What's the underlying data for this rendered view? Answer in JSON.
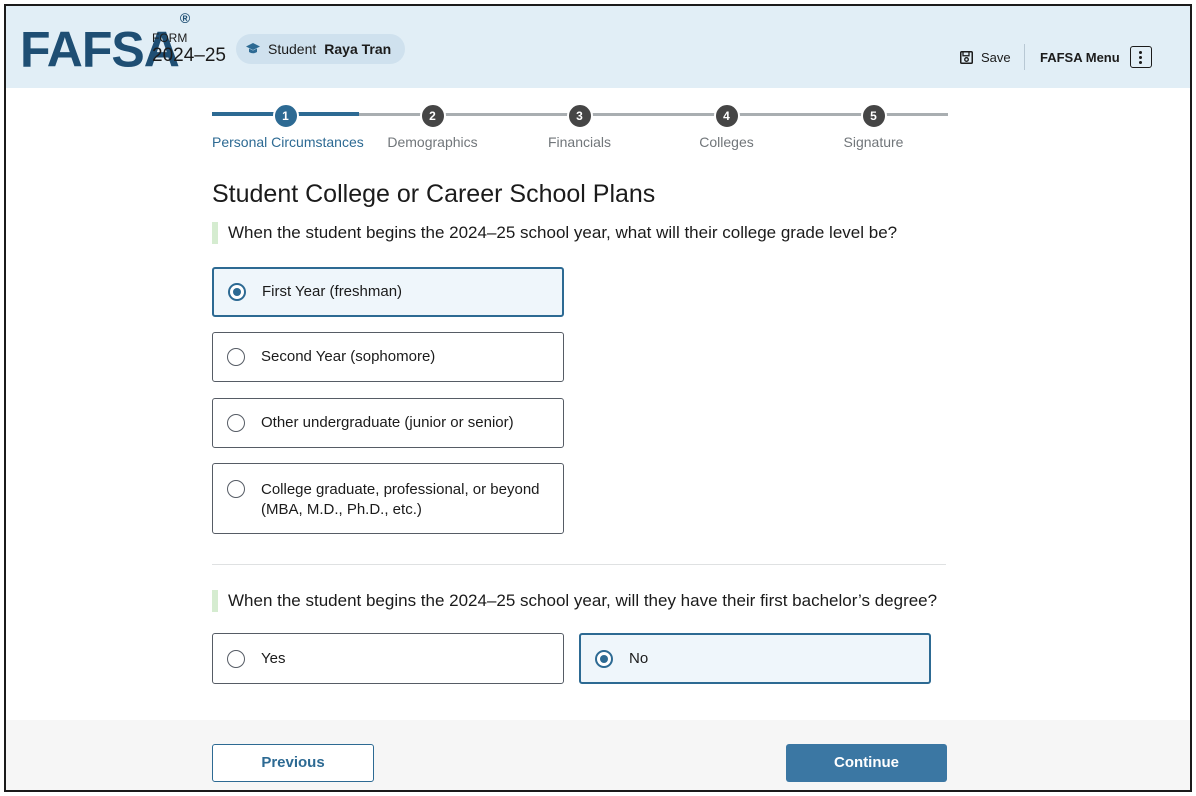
{
  "header": {
    "logo": "FAFSA",
    "logo_mark": "®",
    "form_label": "FORM",
    "form_year": "2024–25",
    "student_prefix": "Student",
    "student_name": "Raya Tran",
    "save_label": "Save",
    "menu_label": "FAFSA Menu"
  },
  "stepper": {
    "steps": [
      {
        "number": "1",
        "label": "Personal Circumstances",
        "state": "active"
      },
      {
        "number": "2",
        "label": "Demographics",
        "state": "upcoming"
      },
      {
        "number": "3",
        "label": "Financials",
        "state": "upcoming"
      },
      {
        "number": "4",
        "label": "Colleges",
        "state": "upcoming"
      },
      {
        "number": "5",
        "label": "Signature",
        "state": "upcoming"
      }
    ]
  },
  "main": {
    "title": "Student College or Career School Plans",
    "question1": {
      "text": "When the student begins the 2024–25 school year, what will their college grade level be?",
      "options": [
        {
          "label": "First Year (freshman)",
          "selected": true
        },
        {
          "label": "Second Year (sophomore)",
          "selected": false
        },
        {
          "label": "Other undergraduate (junior or senior)",
          "selected": false
        },
        {
          "label": "College graduate, professional, or beyond",
          "label_line2": "(MBA, M.D., Ph.D., etc.)",
          "selected": false
        }
      ]
    },
    "question2": {
      "text": "When the student begins the 2024–25 school year, will they have their first bachelor’s degree?",
      "options": [
        {
          "label": "Yes",
          "selected": false
        },
        {
          "label": "No",
          "selected": true
        }
      ]
    }
  },
  "footer": {
    "previous_label": "Previous",
    "continue_label": "Continue"
  },
  "colors": {
    "header_bg": "#e1eef6",
    "brand": "#1e4e73",
    "accent": "#2d6a93",
    "primary_button": "#3b77a3",
    "question_bar": "#d5ecd0"
  }
}
